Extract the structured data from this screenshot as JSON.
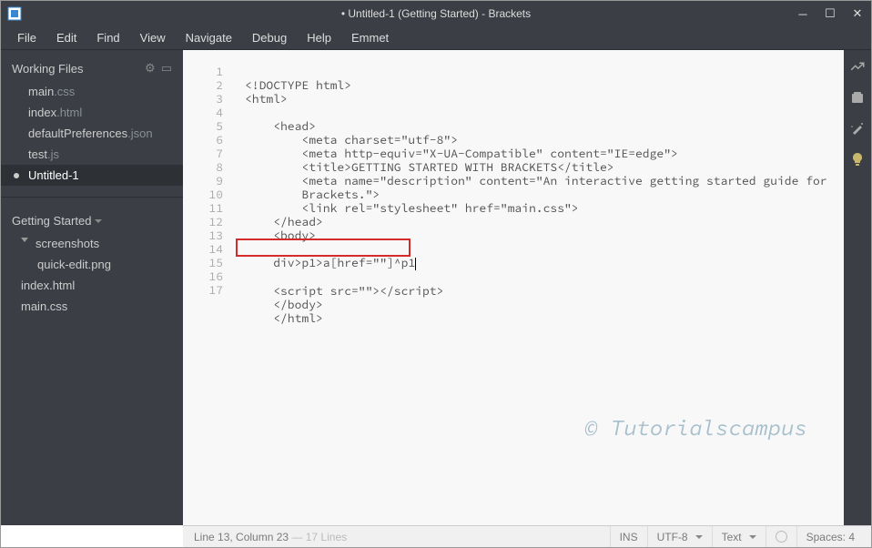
{
  "window": {
    "title": "• Untitled-1 (Getting Started) - Brackets"
  },
  "menu": [
    "File",
    "Edit",
    "Find",
    "View",
    "Navigate",
    "Debug",
    "Help",
    "Emmet"
  ],
  "sidebar": {
    "workingFilesLabel": "Working Files",
    "workingFiles": [
      {
        "name": "main",
        "ext": ".css",
        "active": false
      },
      {
        "name": "index",
        "ext": ".html",
        "active": false
      },
      {
        "name": "defaultPreferences",
        "ext": ".json",
        "active": false
      },
      {
        "name": "test",
        "ext": ".js",
        "active": false
      },
      {
        "name": "Untitled-1",
        "ext": "",
        "active": true
      }
    ],
    "projectLabel": "Getting Started",
    "tree": [
      {
        "name": "screenshots",
        "kind": "folder",
        "level": 0
      },
      {
        "name": "quick-edit",
        "ext": ".png",
        "kind": "file",
        "level": 1
      },
      {
        "name": "index",
        "ext": ".html",
        "kind": "file",
        "level": 0
      },
      {
        "name": "main",
        "ext": ".css",
        "kind": "file",
        "level": 0
      }
    ]
  },
  "editor": {
    "lineCount": 17,
    "lines": [
      "<!DOCTYPE html>",
      "<html>",
      "",
      "    <head>",
      "        <meta charset=\"utf-8\">",
      "        <meta http-equiv=\"X-UA-Compatible\" content=\"IE=edge\">",
      "        <title>GETTING STARTED WITH BRACKETS</title>",
      "        <meta name=\"description\" content=\"An interactive getting started guide for",
      "        Brackets.\">",
      "        <link rel=\"stylesheet\" href=\"main.css\">",
      "    </head>",
      "    <body>",
      "",
      "    div>p1>a[href=\"\"]^p1",
      "",
      "    <script src=\"\"></script>",
      "    </body>",
      "    </html>"
    ],
    "lineNumbers": [
      "1",
      "2",
      "3",
      "4",
      "5",
      "6",
      "7",
      "8",
      "",
      "9",
      "10",
      "11",
      "12",
      "13",
      "14",
      "15",
      "16",
      "17"
    ],
    "highlightedLine": 13,
    "cursorLine": 13,
    "cursorCol": 23
  },
  "statusbar": {
    "position": "Line 13, Column 23",
    "totalLines": "17 Lines",
    "insertMode": "INS",
    "encoding": "UTF-8",
    "language": "Text",
    "spaces": "Spaces: 4"
  },
  "watermark": "© Tutorialscampus"
}
